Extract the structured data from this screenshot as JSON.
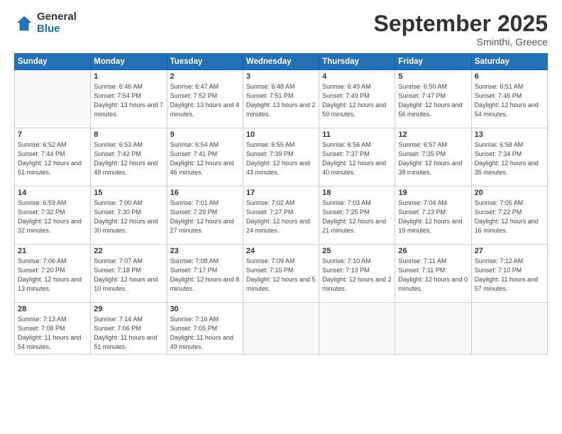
{
  "header": {
    "logo_general": "General",
    "logo_blue": "Blue",
    "title": "September 2025",
    "location": "Sminthi, Greece"
  },
  "weekdays": [
    "Sunday",
    "Monday",
    "Tuesday",
    "Wednesday",
    "Thursday",
    "Friday",
    "Saturday"
  ],
  "weeks": [
    [
      {
        "day": "",
        "sunrise": "",
        "sunset": "",
        "daylight": ""
      },
      {
        "day": "1",
        "sunrise": "Sunrise: 6:46 AM",
        "sunset": "Sunset: 7:54 PM",
        "daylight": "Daylight: 13 hours and 7 minutes."
      },
      {
        "day": "2",
        "sunrise": "Sunrise: 6:47 AM",
        "sunset": "Sunset: 7:52 PM",
        "daylight": "Daylight: 13 hours and 4 minutes."
      },
      {
        "day": "3",
        "sunrise": "Sunrise: 6:48 AM",
        "sunset": "Sunset: 7:51 PM",
        "daylight": "Daylight: 13 hours and 2 minutes."
      },
      {
        "day": "4",
        "sunrise": "Sunrise: 6:49 AM",
        "sunset": "Sunset: 7:49 PM",
        "daylight": "Daylight: 12 hours and 59 minutes."
      },
      {
        "day": "5",
        "sunrise": "Sunrise: 6:50 AM",
        "sunset": "Sunset: 7:47 PM",
        "daylight": "Daylight: 12 hours and 56 minutes."
      },
      {
        "day": "6",
        "sunrise": "Sunrise: 6:51 AM",
        "sunset": "Sunset: 7:46 PM",
        "daylight": "Daylight: 12 hours and 54 minutes."
      }
    ],
    [
      {
        "day": "7",
        "sunrise": "Sunrise: 6:52 AM",
        "sunset": "Sunset: 7:44 PM",
        "daylight": "Daylight: 12 hours and 51 minutes."
      },
      {
        "day": "8",
        "sunrise": "Sunrise: 6:53 AM",
        "sunset": "Sunset: 7:42 PM",
        "daylight": "Daylight: 12 hours and 48 minutes."
      },
      {
        "day": "9",
        "sunrise": "Sunrise: 6:54 AM",
        "sunset": "Sunset: 7:41 PM",
        "daylight": "Daylight: 12 hours and 46 minutes."
      },
      {
        "day": "10",
        "sunrise": "Sunrise: 6:55 AM",
        "sunset": "Sunset: 7:39 PM",
        "daylight": "Daylight: 12 hours and 43 minutes."
      },
      {
        "day": "11",
        "sunrise": "Sunrise: 6:56 AM",
        "sunset": "Sunset: 7:37 PM",
        "daylight": "Daylight: 12 hours and 40 minutes."
      },
      {
        "day": "12",
        "sunrise": "Sunrise: 6:57 AM",
        "sunset": "Sunset: 7:35 PM",
        "daylight": "Daylight: 12 hours and 38 minutes."
      },
      {
        "day": "13",
        "sunrise": "Sunrise: 6:58 AM",
        "sunset": "Sunset: 7:34 PM",
        "daylight": "Daylight: 12 hours and 35 minutes."
      }
    ],
    [
      {
        "day": "14",
        "sunrise": "Sunrise: 6:59 AM",
        "sunset": "Sunset: 7:32 PM",
        "daylight": "Daylight: 12 hours and 32 minutes."
      },
      {
        "day": "15",
        "sunrise": "Sunrise: 7:00 AM",
        "sunset": "Sunset: 7:30 PM",
        "daylight": "Daylight: 12 hours and 30 minutes."
      },
      {
        "day": "16",
        "sunrise": "Sunrise: 7:01 AM",
        "sunset": "Sunset: 7:29 PM",
        "daylight": "Daylight: 12 hours and 27 minutes."
      },
      {
        "day": "17",
        "sunrise": "Sunrise: 7:02 AM",
        "sunset": "Sunset: 7:27 PM",
        "daylight": "Daylight: 12 hours and 24 minutes."
      },
      {
        "day": "18",
        "sunrise": "Sunrise: 7:03 AM",
        "sunset": "Sunset: 7:25 PM",
        "daylight": "Daylight: 12 hours and 21 minutes."
      },
      {
        "day": "19",
        "sunrise": "Sunrise: 7:04 AM",
        "sunset": "Sunset: 7:23 PM",
        "daylight": "Daylight: 12 hours and 19 minutes."
      },
      {
        "day": "20",
        "sunrise": "Sunrise: 7:05 AM",
        "sunset": "Sunset: 7:22 PM",
        "daylight": "Daylight: 12 hours and 16 minutes."
      }
    ],
    [
      {
        "day": "21",
        "sunrise": "Sunrise: 7:06 AM",
        "sunset": "Sunset: 7:20 PM",
        "daylight": "Daylight: 12 hours and 13 minutes."
      },
      {
        "day": "22",
        "sunrise": "Sunrise: 7:07 AM",
        "sunset": "Sunset: 7:18 PM",
        "daylight": "Daylight: 12 hours and 10 minutes."
      },
      {
        "day": "23",
        "sunrise": "Sunrise: 7:08 AM",
        "sunset": "Sunset: 7:17 PM",
        "daylight": "Daylight: 12 hours and 8 minutes."
      },
      {
        "day": "24",
        "sunrise": "Sunrise: 7:09 AM",
        "sunset": "Sunset: 7:15 PM",
        "daylight": "Daylight: 12 hours and 5 minutes."
      },
      {
        "day": "25",
        "sunrise": "Sunrise: 7:10 AM",
        "sunset": "Sunset: 7:13 PM",
        "daylight": "Daylight: 12 hours and 2 minutes."
      },
      {
        "day": "26",
        "sunrise": "Sunrise: 7:11 AM",
        "sunset": "Sunset: 7:11 PM",
        "daylight": "Daylight: 12 hours and 0 minutes."
      },
      {
        "day": "27",
        "sunrise": "Sunrise: 7:12 AM",
        "sunset": "Sunset: 7:10 PM",
        "daylight": "Daylight: 11 hours and 57 minutes."
      }
    ],
    [
      {
        "day": "28",
        "sunrise": "Sunrise: 7:13 AM",
        "sunset": "Sunset: 7:08 PM",
        "daylight": "Daylight: 11 hours and 54 minutes."
      },
      {
        "day": "29",
        "sunrise": "Sunrise: 7:14 AM",
        "sunset": "Sunset: 7:06 PM",
        "daylight": "Daylight: 11 hours and 51 minutes."
      },
      {
        "day": "30",
        "sunrise": "Sunrise: 7:16 AM",
        "sunset": "Sunset: 7:05 PM",
        "daylight": "Daylight: 11 hours and 49 minutes."
      },
      {
        "day": "",
        "sunrise": "",
        "sunset": "",
        "daylight": ""
      },
      {
        "day": "",
        "sunrise": "",
        "sunset": "",
        "daylight": ""
      },
      {
        "day": "",
        "sunrise": "",
        "sunset": "",
        "daylight": ""
      },
      {
        "day": "",
        "sunrise": "",
        "sunset": "",
        "daylight": ""
      }
    ]
  ]
}
